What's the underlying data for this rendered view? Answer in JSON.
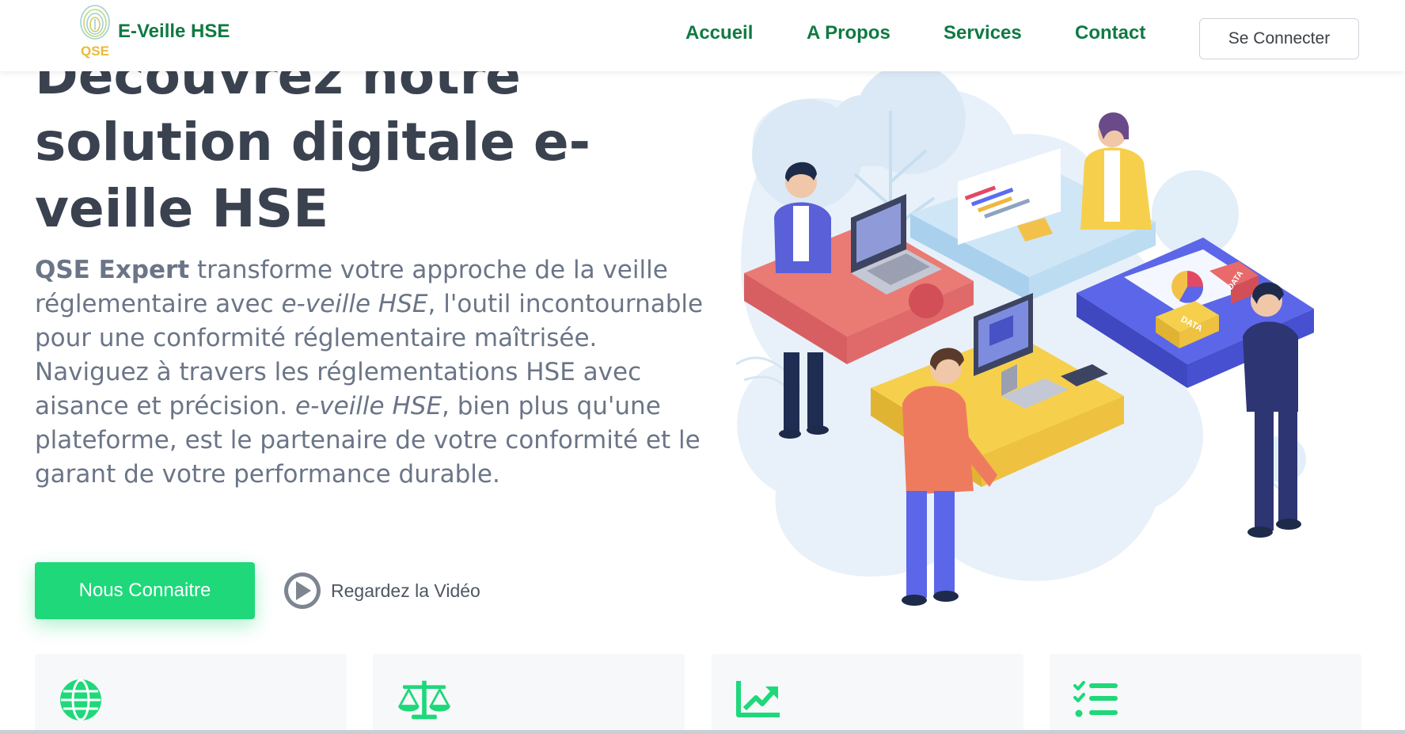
{
  "header": {
    "brand": "E-Veille HSE",
    "logo_text": "QSE",
    "nav": [
      "Accueil",
      "A Propos",
      "Services",
      "Contact"
    ],
    "login_label": "Se Connecter"
  },
  "hero": {
    "title": "Découvrez notre solution digitale e-veille HSE",
    "text": {
      "brand": "QSE Expert",
      "p1": " transforme votre approche de la veille réglementaire avec ",
      "product": "e-veille HSE",
      "p2": ", l'outil incontournable pour une conformité réglementaire maîtrisée. Naviguez à travers les réglementations HSE avec aisance et précision. ",
      "product2": "e-veille HSE",
      "p3": ", bien plus qu'une plateforme, est le partenaire de votre conformité et le garant de votre performance durable."
    },
    "cta_label": "Nous Connaitre",
    "video_label": "Regardez la Vidéo"
  },
  "illustration": {
    "tags": [
      "DATA",
      "DATA"
    ]
  },
  "features": {
    "icons": [
      "globe-icon",
      "balance-scale-icon",
      "chart-line-icon",
      "checklist-icon"
    ]
  },
  "colors": {
    "brand_green": "#0f7a43",
    "accent_green": "#1ed87a",
    "title": "#3a4250",
    "body_text": "#6b7587"
  }
}
